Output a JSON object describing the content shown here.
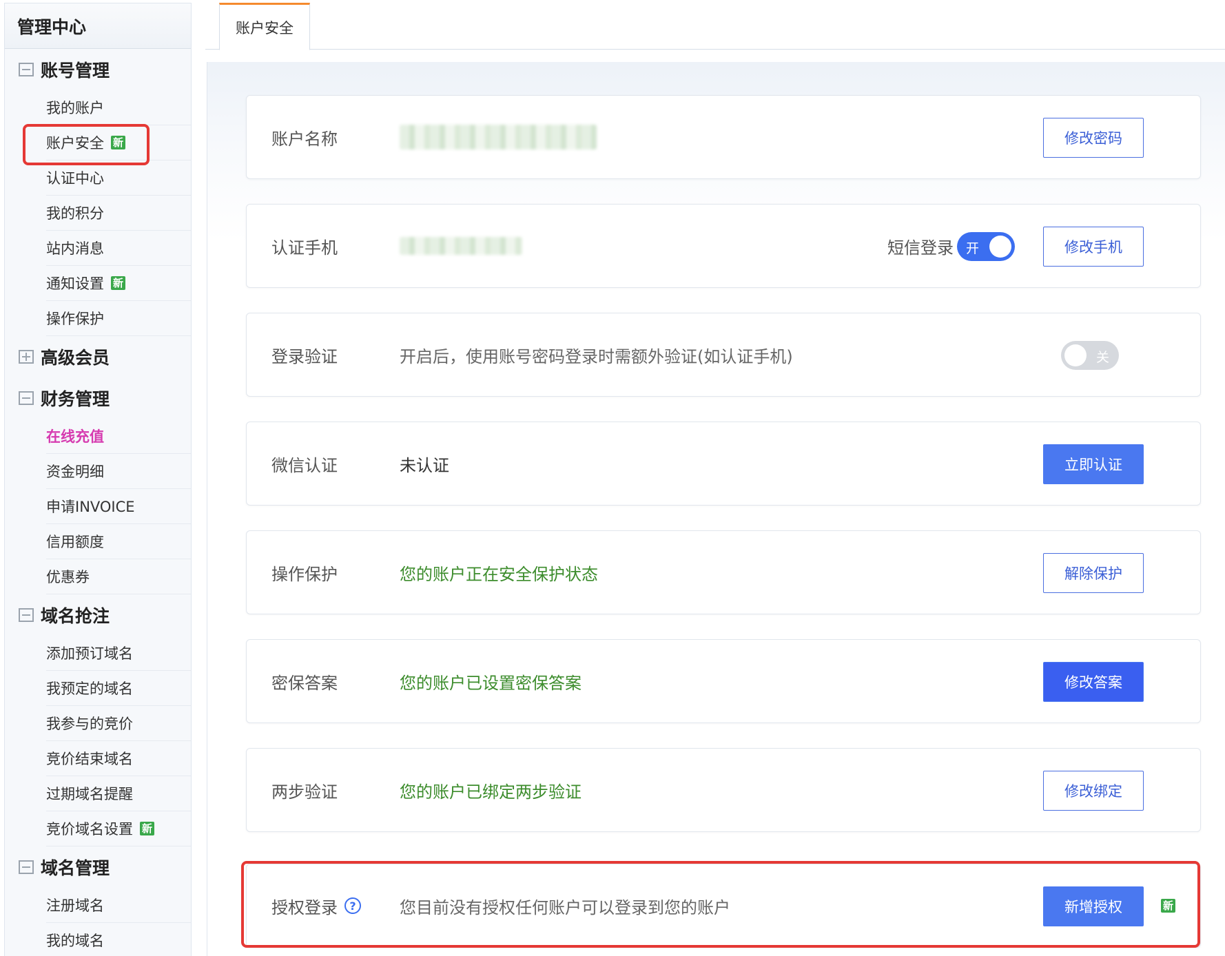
{
  "sidebar": {
    "title": "管理中心",
    "groups": [
      {
        "title": "账号管理",
        "expanded": true,
        "items": [
          {
            "label": "我的账户"
          },
          {
            "label": "账户安全",
            "badge": "新"
          },
          {
            "label": "认证中心"
          },
          {
            "label": "我的积分"
          },
          {
            "label": "站内消息"
          },
          {
            "label": "通知设置",
            "badge": "新"
          },
          {
            "label": "操作保护"
          }
        ]
      },
      {
        "title": "高级会员",
        "expanded": false,
        "items": []
      },
      {
        "title": "财务管理",
        "expanded": true,
        "items": [
          {
            "label": "在线充值"
          },
          {
            "label": "资金明细"
          },
          {
            "label": "申请INVOICE"
          },
          {
            "label": "信用额度"
          },
          {
            "label": "优惠券"
          }
        ]
      },
      {
        "title": "域名抢注",
        "expanded": true,
        "items": [
          {
            "label": "添加预订域名"
          },
          {
            "label": "我预定的域名"
          },
          {
            "label": "我参与的竞价"
          },
          {
            "label": "竞价结束域名"
          },
          {
            "label": "过期域名提醒"
          },
          {
            "label": "竞价域名设置",
            "badge": "新"
          }
        ]
      },
      {
        "title": "域名管理",
        "expanded": true,
        "items": [
          {
            "label": "注册域名"
          },
          {
            "label": "我的域名"
          }
        ]
      }
    ]
  },
  "tabs": [
    {
      "label": "账户安全"
    }
  ],
  "cards": {
    "account_name": {
      "label": "账户名称",
      "button": "修改密码"
    },
    "phone": {
      "label": "认证手机",
      "sms_label": "短信登录",
      "toggle_text": "开",
      "button": "修改手机"
    },
    "login_verify": {
      "label": "登录验证",
      "desc": "开启后，使用账号密码登录时需额外验证(如认证手机)",
      "toggle_text": "关"
    },
    "wechat": {
      "label": "微信认证",
      "value": "未认证",
      "button": "立即认证"
    },
    "op_protect": {
      "label": "操作保护",
      "value": "您的账户正在安全保护状态",
      "button": "解除保护"
    },
    "security_qa": {
      "label": "密保答案",
      "value": "您的账户已设置密保答案",
      "button": "修改答案"
    },
    "two_step": {
      "label": "两步验证",
      "value": "您的账户已绑定两步验证",
      "button": "修改绑定"
    },
    "auth_login": {
      "label": "授权登录",
      "help": "?",
      "value": "您目前没有授权任何账户可以登录到您的账户",
      "button": "新增授权",
      "badge": "新"
    }
  },
  "colors": {
    "accent": "#4a78f0",
    "highlight": "#e53935",
    "success_text": "#3c8c2c",
    "badge_green": "#3aa84a",
    "active_pink": "#d63bb0",
    "tab_top": "#f58a2e"
  }
}
